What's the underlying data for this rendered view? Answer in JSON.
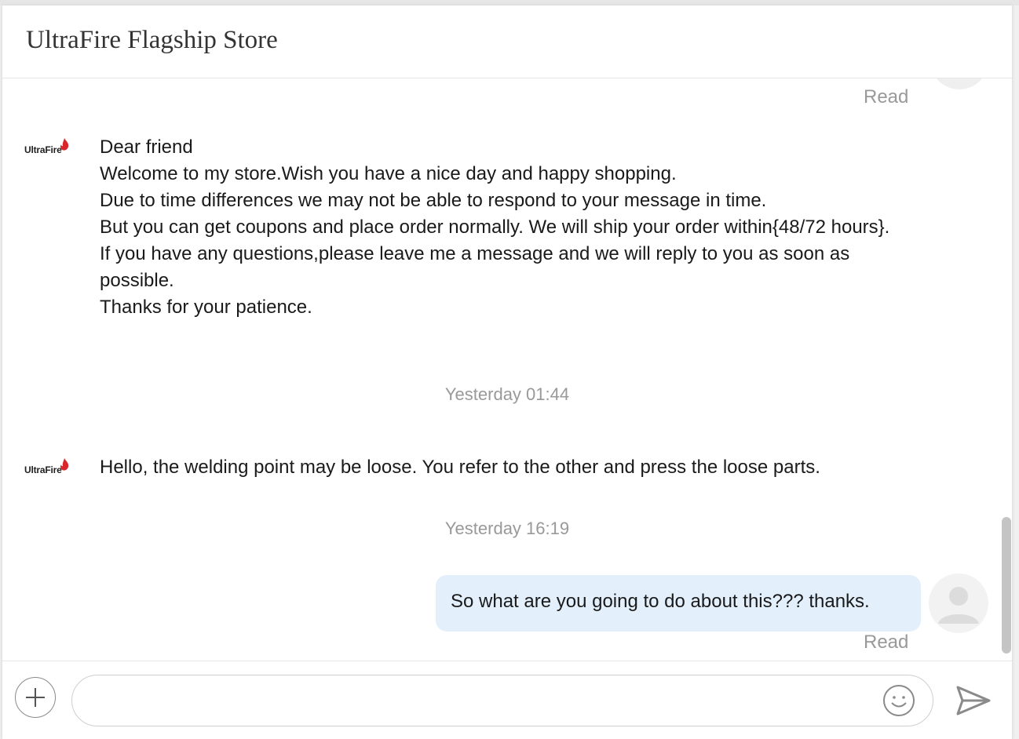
{
  "header": {
    "title": "UltraFire Flagship Store"
  },
  "store": {
    "logo_text": "UltraFire"
  },
  "messages": {
    "top_read": "Read",
    "welcome_lines": [
      "Dear friend",
      "Welcome to my store.Wish you have a nice day and happy shopping.",
      "Due to time differences we may not be able to respond to your message in time.",
      "But you can get coupons and place order  normally. We will ship your order within{48/72 hours}.",
      "If you have any questions,please leave me a message and we will reply to you as soon as possible.",
      "Thanks for your patience."
    ],
    "timestamp_1": "Yesterday 01:44",
    "store_reply": "Hello, the welding point may be loose. You refer to the other and press the loose parts.",
    "timestamp_2": "Yesterday 16:19",
    "user_message": "So what are you going to do about this??? thanks.",
    "user_read": "Read"
  },
  "composer": {
    "input_value": "",
    "placeholder": ""
  },
  "icons": {
    "add": "plus-icon",
    "emoji": "smiley-icon",
    "send": "send-icon",
    "avatar": "user-avatar-icon",
    "logo_flame": "flame-icon"
  },
  "colors": {
    "user_bubble": "#e3f0fc",
    "timestamp": "#999999",
    "logo_flame": "#d9262a"
  }
}
